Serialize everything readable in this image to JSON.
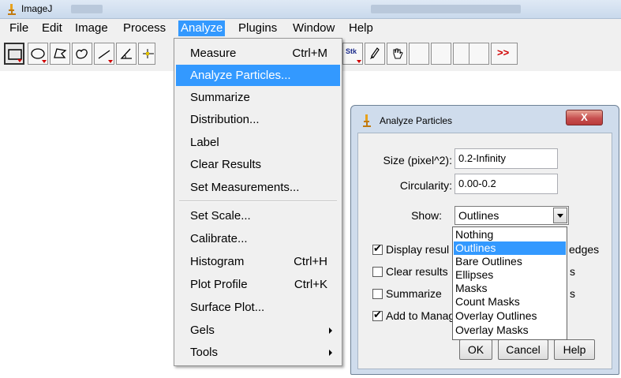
{
  "window": {
    "title": "ImageJ"
  },
  "menubar": {
    "items": [
      "File",
      "Edit",
      "Image",
      "Process",
      "Analyze",
      "Plugins",
      "Window",
      "Help"
    ],
    "active": "Analyze"
  },
  "toolbar": {
    "stk_label": "Stk",
    "more_label": ">>"
  },
  "analyze_menu": {
    "items": [
      {
        "label": "Measure",
        "shortcut": "Ctrl+M"
      },
      {
        "label": "Analyze Particles...",
        "highlighted": true
      },
      {
        "label": "Summarize"
      },
      {
        "label": "Distribution..."
      },
      {
        "label": "Label"
      },
      {
        "label": "Clear Results"
      },
      {
        "label": "Set Measurements..."
      },
      {
        "label": "Set Scale..."
      },
      {
        "label": "Calibrate..."
      },
      {
        "label": "Histogram",
        "shortcut": "Ctrl+H"
      },
      {
        "label": "Plot Profile",
        "shortcut": "Ctrl+K"
      },
      {
        "label": "Surface Plot..."
      },
      {
        "label": "Gels",
        "submenu": true
      },
      {
        "label": "Tools",
        "submenu": true
      }
    ]
  },
  "dialog": {
    "title": "Analyze Particles",
    "close_label": "X",
    "size_label": "Size (pixel^2):",
    "size_value": "0.2-Infinity",
    "circularity_label": "Circularity:",
    "circularity_value": "0.00-0.2",
    "show_label": "Show:",
    "show_value": "Outlines",
    "checkboxes": [
      {
        "label": "Display resul",
        "checked": true
      },
      {
        "label": "Clear results",
        "checked": false
      },
      {
        "label": "Summarize",
        "checked": false
      },
      {
        "label": "Add to Manag",
        "checked": true
      }
    ],
    "right_fragments": [
      "edges",
      "s",
      "s"
    ],
    "ok_label": "OK",
    "cancel_label": "Cancel",
    "help_label": "Help"
  },
  "show_dropdown": {
    "options": [
      "Nothing",
      "Outlines",
      "Bare Outlines",
      "Ellipses",
      "Masks",
      "Count Masks",
      "Overlay Outlines",
      "Overlay Masks"
    ],
    "selected": "Outlines"
  },
  "colors": {
    "menu_highlight": "#3399ff",
    "menubar_bg": "#f0f0f0",
    "dialog_frame": "#cfdcec",
    "close_button": "#c75050",
    "tool_marker": "#d00000",
    "app_icon": "#e8a21c"
  }
}
